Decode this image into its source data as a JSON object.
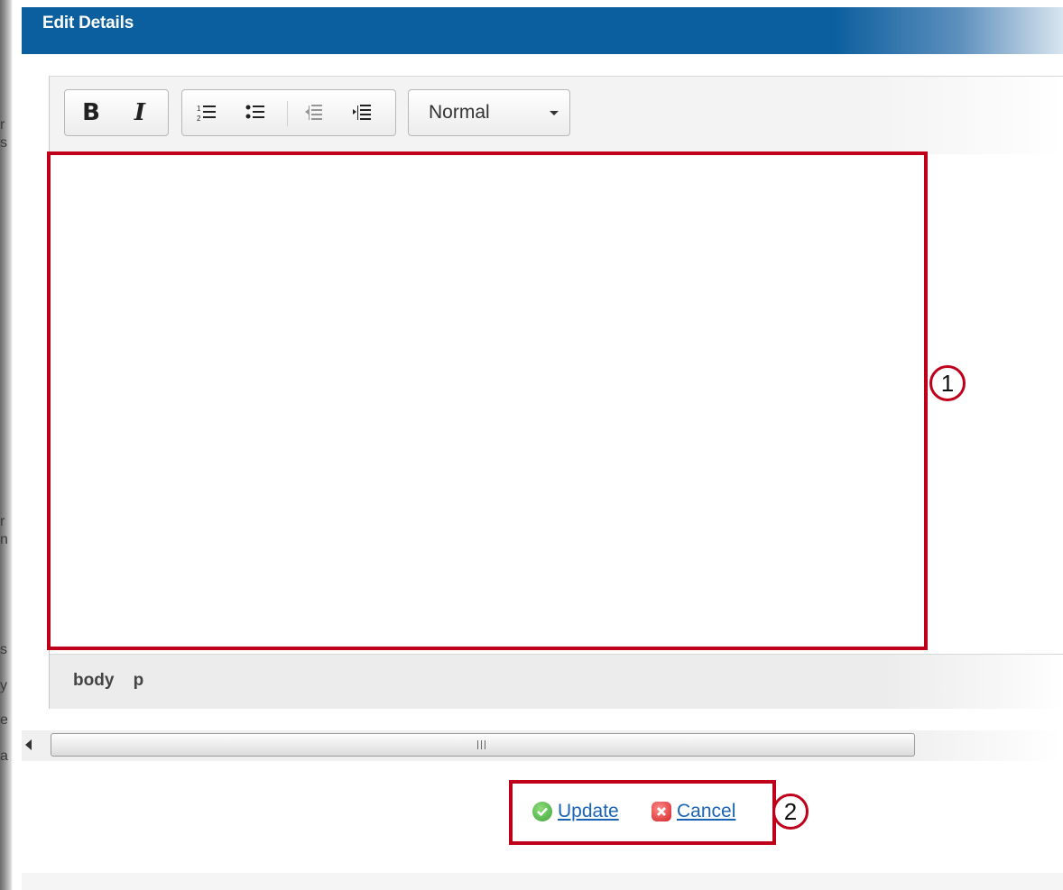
{
  "dialog": {
    "title": "Edit Details"
  },
  "toolbar": {
    "bold_icon": "B",
    "italic_icon": "I",
    "format_value": "Normal",
    "icons": [
      "bold-icon",
      "italic-icon",
      "numbered-list-icon",
      "bulleted-list-icon",
      "outdent-icon",
      "indent-icon"
    ]
  },
  "editor": {
    "content": ""
  },
  "statusbar": {
    "path": [
      "body",
      "p"
    ]
  },
  "scrollbar": {
    "grip": "III"
  },
  "actions": {
    "update_label": "Update",
    "cancel_label": "Cancel"
  },
  "annotations": {
    "one": "1",
    "two": "2"
  },
  "colors": {
    "titlebar": "#0b5f9e",
    "annotation": "#c0001a",
    "link": "#1a64b5"
  }
}
